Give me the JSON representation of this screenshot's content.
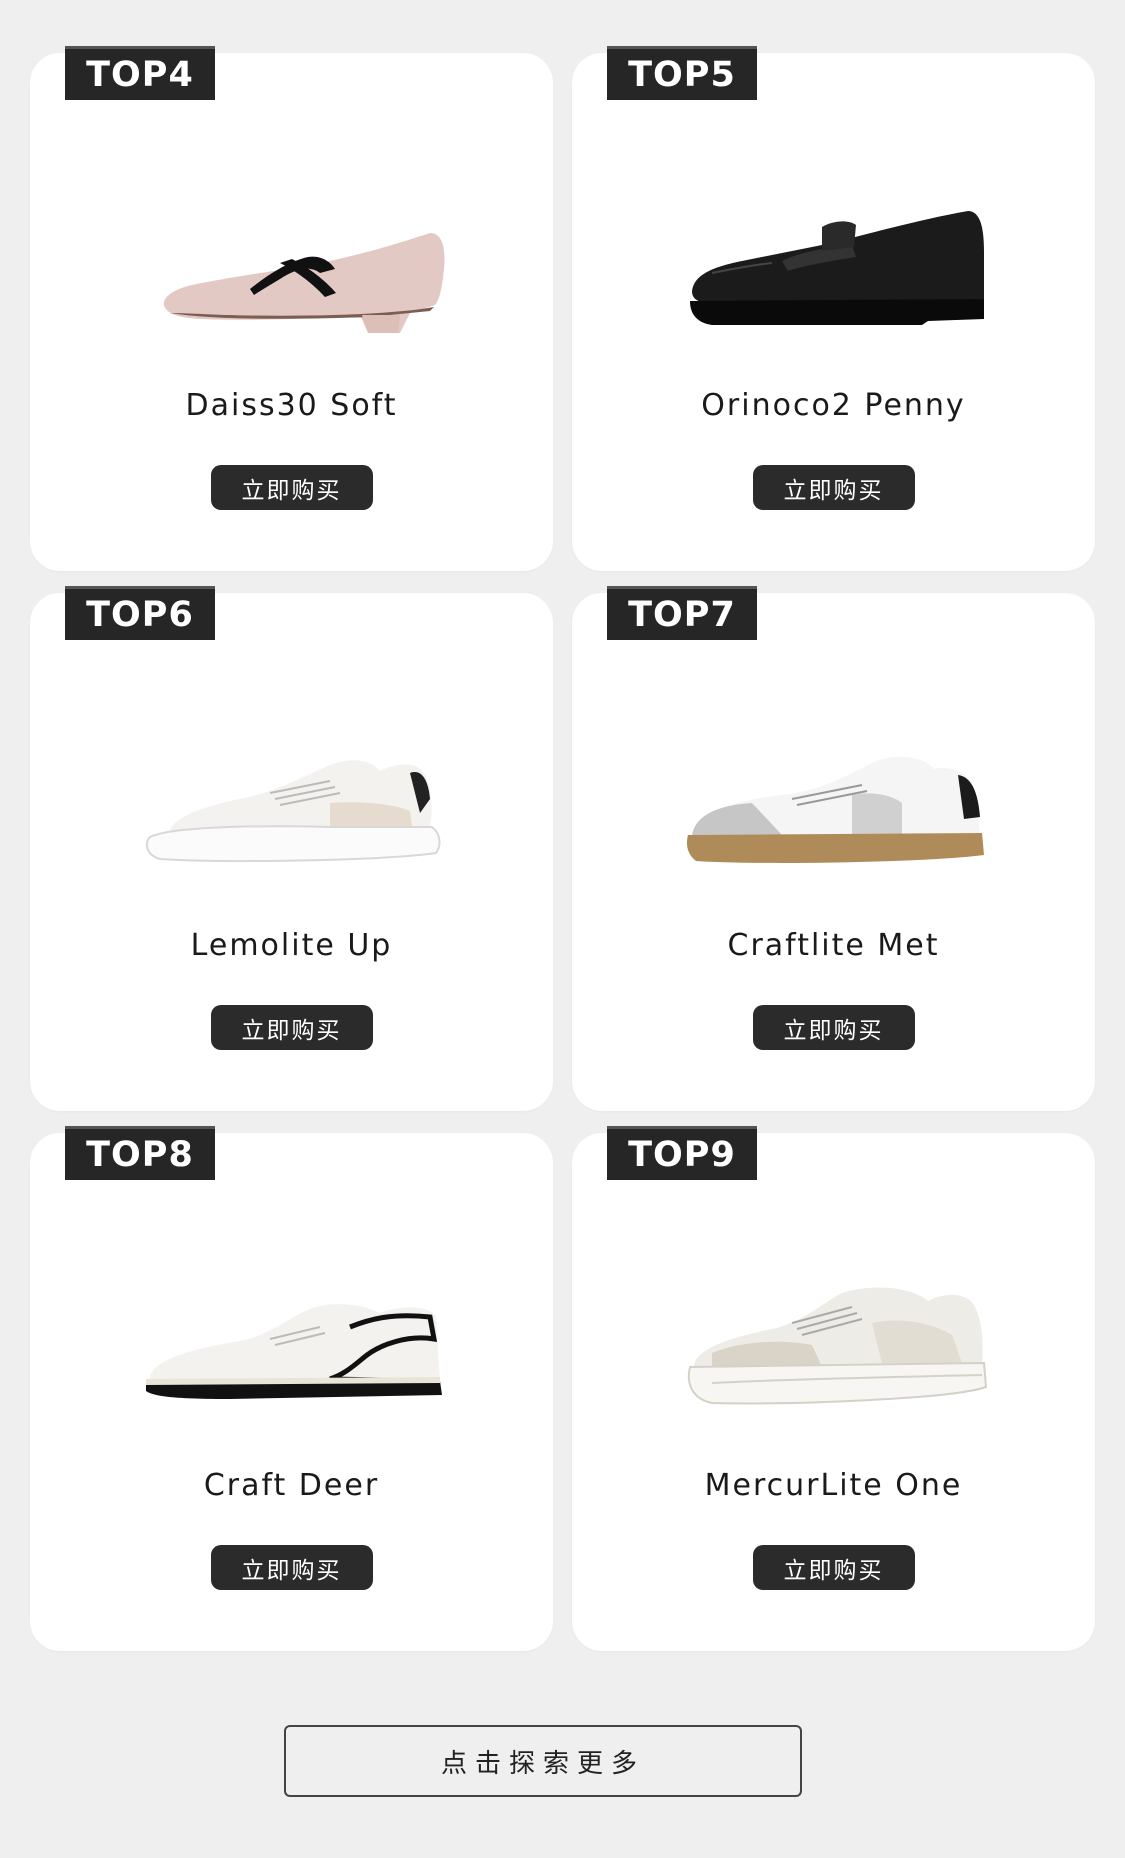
{
  "products": [
    {
      "rank": "TOP4",
      "name": "Daiss30 Soft",
      "button": "立即购买",
      "image": "beige-mary-jane-heel"
    },
    {
      "rank": "TOP5",
      "name": "Orinoco2 Penny",
      "button": "立即购买",
      "image": "black-penny-loafer"
    },
    {
      "rank": "TOP6",
      "name": "Lemolite Up",
      "button": "立即购买",
      "image": "white-platform-sneaker"
    },
    {
      "rank": "TOP7",
      "name": "Craftlite Met",
      "button": "立即购买",
      "image": "silver-gum-sole-sneaker"
    },
    {
      "rank": "TOP8",
      "name": "Craft Deer",
      "button": "立即购买",
      "image": "white-black-stripe-sneaker"
    },
    {
      "rank": "TOP9",
      "name": "MercurLite One",
      "button": "立即购买",
      "image": "chunky-white-sneaker"
    }
  ],
  "explore_button": "点击探索更多",
  "colors": {
    "background": "#efefef",
    "card": "#ffffff",
    "badge": "#262626",
    "button": "#2b2b2b"
  }
}
